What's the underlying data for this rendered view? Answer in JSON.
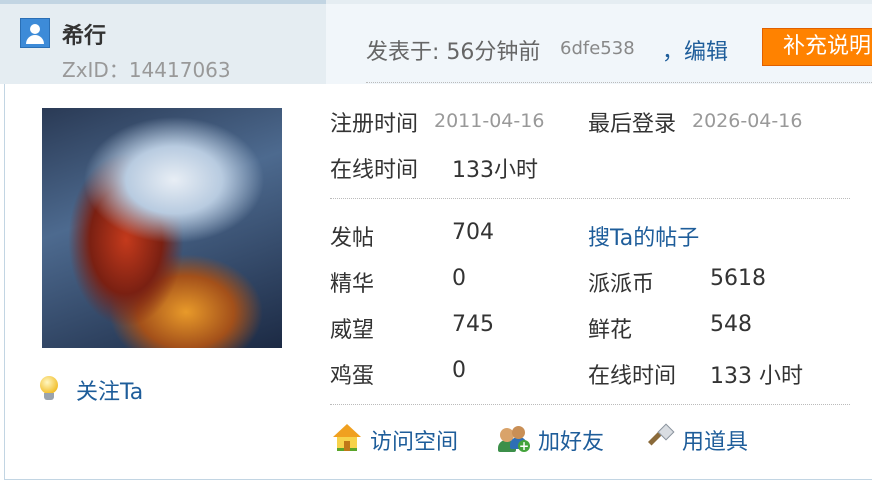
{
  "user": {
    "name": "希行",
    "zxid": "ZxID：14417063",
    "avatar_icon": "user-avatar-icon",
    "follow_label": "关注Ta"
  },
  "post": {
    "posted_prefix": "发表于: 56分钟前",
    "hash": "6dfe538",
    "edit_label": "，编辑",
    "supplement_label": "补充说明"
  },
  "profile": {
    "register_label": "注册时间",
    "register_value": "2011-04-16",
    "last_login_label": "最后登录",
    "last_login_value": "2026-04-16",
    "online_label": "在线时间",
    "online_value": "133小时"
  },
  "stats": {
    "posts_label": "发帖",
    "posts_value": "704",
    "search_posts_link": "搜Ta的帖子",
    "digest_label": "精华",
    "digest_value": "0",
    "coins_label": "派派币",
    "coins_value": "5618",
    "prestige_label": "威望",
    "prestige_value": "745",
    "flowers_label": "鲜花",
    "flowers_value": "548",
    "eggs_label": "鸡蛋",
    "eggs_value": "0",
    "online2_label": "在线时间",
    "online2_value": "133 小时"
  },
  "actions": {
    "visit_space": "访问空间",
    "add_friend": "加好友",
    "use_item": "用道具"
  },
  "colors": {
    "link": "#1e5d9a",
    "accent_button": "#ff8200",
    "header_bg": "#e5edf2"
  }
}
